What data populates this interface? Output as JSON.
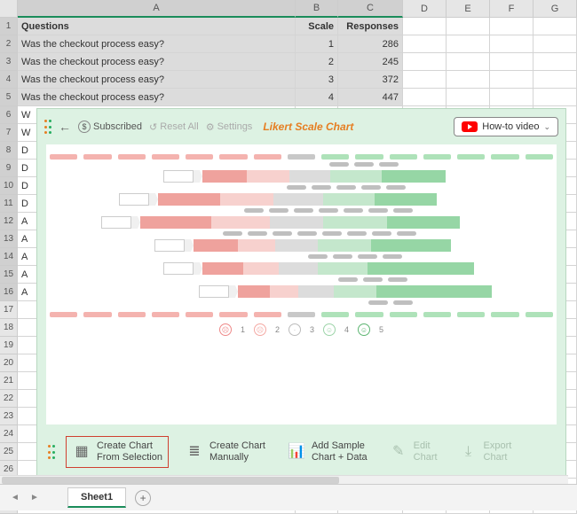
{
  "columns": [
    "A",
    "B",
    "C",
    "D",
    "E",
    "F",
    "G"
  ],
  "row_count": 28,
  "selected_rows": [
    1,
    2,
    3,
    4,
    5
  ],
  "selected_cols": [
    "A",
    "B",
    "C"
  ],
  "header_row": {
    "A": "Questions",
    "B": "Scale",
    "C": "Responses"
  },
  "data_rows": [
    {
      "A": "Was the checkout process easy?",
      "B": "1",
      "C": "286"
    },
    {
      "A": "Was the checkout process easy?",
      "B": "2",
      "C": "245"
    },
    {
      "A": "Was the checkout process easy?",
      "B": "3",
      "C": "372"
    },
    {
      "A": "Was the checkout process easy?",
      "B": "4",
      "C": "447"
    }
  ],
  "clipped_rows": [
    {
      "A": "W"
    },
    {
      "A": "W"
    },
    {
      "A": "D"
    },
    {
      "A": "D"
    },
    {
      "A": "D"
    },
    {
      "A": "D"
    },
    {
      "A": "A"
    },
    {
      "A": "A"
    },
    {
      "A": "A"
    },
    {
      "A": "A"
    },
    {
      "A": "A"
    }
  ],
  "panel": {
    "status": "Subscribed",
    "reset": "Reset All",
    "settings": "Settings",
    "title": "Likert Scale Chart",
    "howto": "How-to video",
    "legend": [
      "1",
      "2",
      "3",
      "4",
      "5"
    ],
    "buttons": {
      "create_selection": "Create Chart\nFrom Selection",
      "create_manual": "Create Chart\nManually",
      "add_sample": "Add Sample\nChart + Data",
      "edit": "Edit\nChart",
      "export": "Export\nChart"
    }
  },
  "tabs": {
    "sheet1": "Sheet1"
  }
}
